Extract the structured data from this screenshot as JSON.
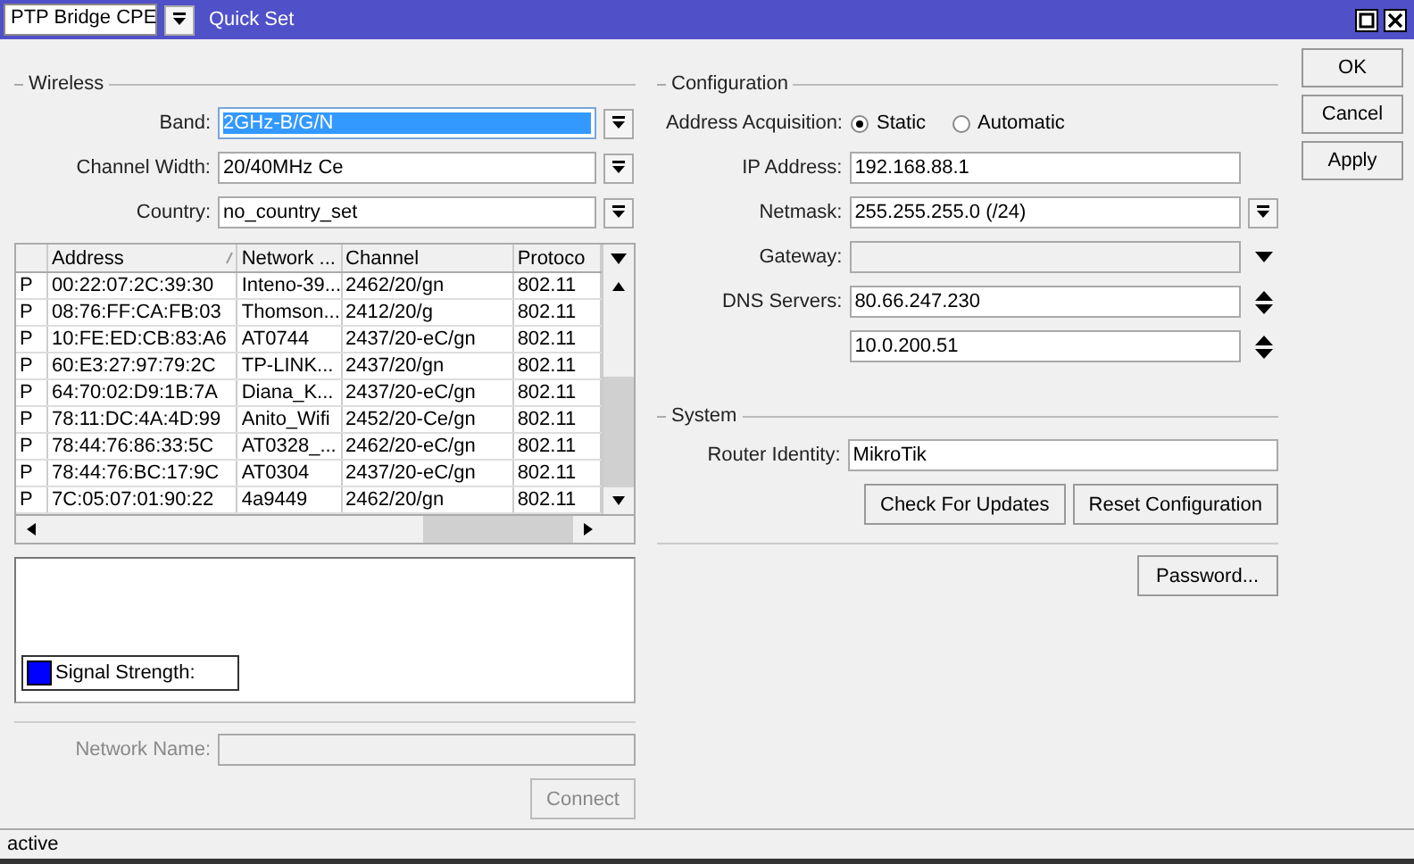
{
  "title_bar": {
    "mode": "PTP Bridge CPE",
    "title": "Quick Set"
  },
  "wireless": {
    "title": "Wireless",
    "fields": [
      {
        "label": "Band:",
        "value": "2GHz-B/G/N",
        "selected": true
      },
      {
        "label": "Channel Width:",
        "value": "20/40MHz Ce",
        "selected": false
      },
      {
        "label": "Country:",
        "value": "no_country_set",
        "selected": false
      }
    ],
    "scan_table": {
      "columns": [
        "",
        "Address",
        "Network ...",
        "Channel",
        "Protoco"
      ],
      "rows": [
        [
          "P",
          "00:22:07:2C:39:30",
          "Inteno-39...",
          "2462/20/gn",
          "802.11"
        ],
        [
          "P",
          "08:76:FF:CA:FB:03",
          "Thomson...",
          "2412/20/g",
          "802.11"
        ],
        [
          "P",
          "10:FE:ED:CB:83:A6",
          "AT0744",
          "2437/20-eC/gn",
          "802.11"
        ],
        [
          "P",
          "60:E3:27:97:79:2C",
          "TP-LINK...",
          "2437/20/gn",
          "802.11"
        ],
        [
          "P",
          "64:70:02:D9:1B:7A",
          "Diana_K...",
          "2437/20-eC/gn",
          "802.11"
        ],
        [
          "P",
          "78:11:DC:4A:4D:99",
          "Anito_Wifi",
          "2452/20-Ce/gn",
          "802.11"
        ],
        [
          "P",
          "78:44:76:86:33:5C",
          "AT0328_...",
          "2462/20-eC/gn",
          "802.11"
        ],
        [
          "P",
          "78:44:76:BC:17:9C",
          "AT0304",
          "2437/20-eC/gn",
          "802.11"
        ],
        [
          "P",
          "7C:05:07:01:90:22",
          "4a9449",
          "2462/20/gn",
          "802.11"
        ]
      ]
    },
    "signal_legend": {
      "label": "Signal Strength:"
    },
    "network_name": {
      "label": "Network Name:",
      "disabled": true
    },
    "connect_button": {
      "label": "Connect",
      "disabled": true
    }
  },
  "configuration": {
    "title": "Configuration",
    "address_acquisition": {
      "label": "Address Acquisition:",
      "options": [
        {
          "label": "Static",
          "selected": true
        },
        {
          "label": "Automatic",
          "selected": false
        }
      ]
    },
    "fields": [
      {
        "kind": "text",
        "label": "IP Address:",
        "value": "192.168.88.1",
        "disabled": false
      },
      {
        "kind": "select",
        "label": "Netmask:",
        "value": "255.255.255.0 (/24)",
        "disabled": false
      },
      {
        "kind": "combo",
        "label": "Gateway:",
        "disabled": true
      },
      {
        "kind": "spin",
        "label": "DNS Servers:",
        "value": "80.66.247.230",
        "disabled": false
      },
      {
        "kind": "spin",
        "value": "10.0.200.51",
        "disabled": false
      }
    ]
  },
  "system": {
    "title": "System",
    "router_identity": {
      "label": "Router Identity:",
      "value": "MikroTik"
    },
    "buttons": [
      "Check For Updates",
      "Reset Configuration"
    ],
    "password_button": "Password..."
  },
  "buttons": [
    "OK",
    "Cancel",
    "Apply"
  ],
  "status_bar": "active"
}
